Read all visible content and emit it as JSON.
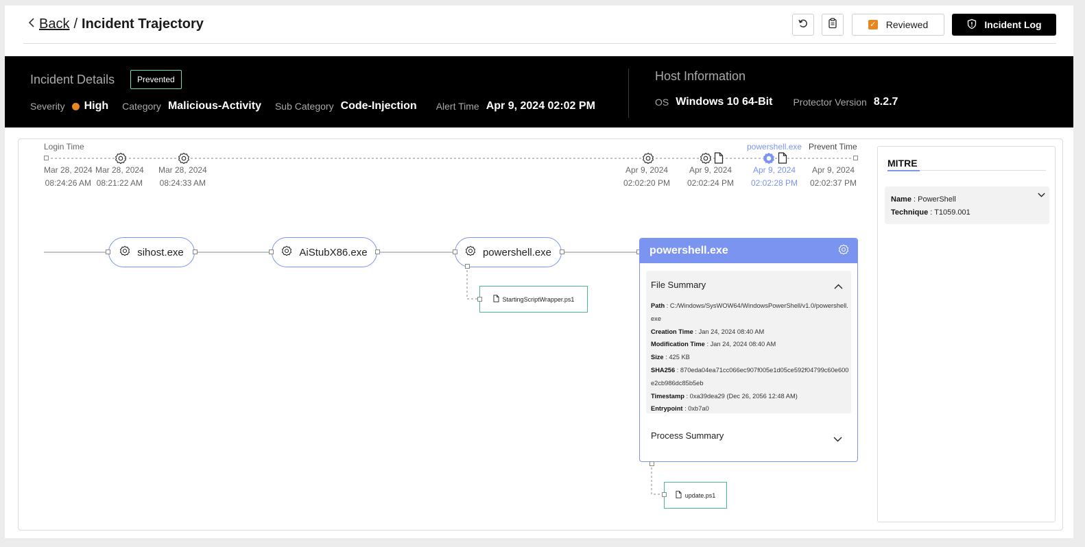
{
  "header": {
    "back_label": "Back",
    "separator": "/",
    "title": "Incident Trajectory",
    "reviewed_label": "Reviewed",
    "incident_log_label": "Incident Log",
    "icons": [
      "undo-icon",
      "clipboard-icon",
      "checkbox-icon",
      "shield-alert-icon"
    ]
  },
  "incident": {
    "title": "Incident Details",
    "status_badge": "Prevented",
    "severity_label": "Severity",
    "severity_value": "High",
    "category_label": "Category",
    "category_value": "Malicious-Activity",
    "subcategory_label": "Sub Category",
    "subcategory_value": "Code-Injection",
    "alert_time_label": "Alert Time",
    "alert_time_value": "Apr 9, 2024 02:02 PM"
  },
  "host": {
    "title": "Host Information",
    "os_label": "OS",
    "os_value": "Windows 10 64-Bit",
    "protector_label": "Protector Version",
    "protector_value": "8.2.7"
  },
  "timeline": {
    "login_label": "Login Time",
    "prevent_label": "Prevent Time",
    "active_label": "powershell.exe",
    "events": [
      {
        "date": "Mar 28, 2024",
        "time": "08:24:26 AM",
        "icon": "none"
      },
      {
        "date": "Mar 28, 2024",
        "time": "08:21:22 AM",
        "icon": "gear-icon"
      },
      {
        "date": "Mar 28, 2024",
        "time": "08:24:33 AM",
        "icon": "gear-icon"
      },
      {
        "date": "Apr 9, 2024",
        "time": "02:02:20 PM",
        "icon": "gear-icon"
      },
      {
        "date": "Apr 9, 2024",
        "time": "02:02:24 PM",
        "icon": "gear-file-icon"
      },
      {
        "date": "Apr 9, 2024",
        "time": "02:02:28 PM",
        "icon": "gear-file-icon",
        "active": true
      },
      {
        "date": "Apr 9, 2024",
        "time": "02:02:37 PM",
        "icon": "none"
      }
    ]
  },
  "graph": {
    "nodes": [
      "sihost.exe",
      "AiStubX86.exe",
      "powershell.exe"
    ],
    "files": [
      "StartingScriptWrapper.ps1",
      "update.ps1"
    ]
  },
  "panel": {
    "title": "powershell.exe",
    "file_summary_title": "File Summary",
    "fields": [
      {
        "label": "Path",
        "value": "C:/Windows/SysWOW64/WindowsPowerShell/v1.0/powershell.exe"
      },
      {
        "label": "Creation Time",
        "value": "Jan 24, 2024 08:40 AM"
      },
      {
        "label": "Modification Time",
        "value": "Jan 24, 2024 08:40 AM"
      },
      {
        "label": "Size",
        "value": "425 KB"
      },
      {
        "label": "SHA256",
        "value": "870eda04ea71cc066ec907f005e1d05ce592f04799c60e600e2cb986dc85b5eb"
      },
      {
        "label": "Timestamp",
        "value": "0xa39dea29 (Dec 26, 2056 12:48 AM)"
      },
      {
        "label": "Entrypoint",
        "value": "0xb7a0"
      }
    ],
    "process_summary_title": "Process Summary"
  },
  "mitre": {
    "title": "MITRE",
    "name_label": "Name",
    "name_value": "PowerShell",
    "technique_label": "Technique",
    "technique_value": "T1059.001"
  },
  "colors": {
    "accent": "#7a94f0",
    "severity": "#e8861f",
    "badge_border": "#6fe0b2",
    "file_border": "#4cb88a",
    "banner_bg": "#000000"
  }
}
